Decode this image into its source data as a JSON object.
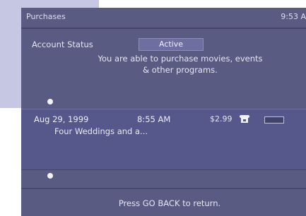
{
  "screen": {
    "title": "Purchases",
    "clock": "9:53 A"
  },
  "account": {
    "status_label": "Account Status",
    "status_value": "Active",
    "message_line1": "You are able to purchase movies, events",
    "message_line2": "& other programs."
  },
  "purchases": [
    {
      "date": "Aug 29, 1999",
      "time": "8:55 AM",
      "price": "$2.99",
      "title": "Four Weddings and a..."
    }
  ],
  "footer": {
    "instruction": "Press GO BACK to return."
  },
  "colors": {
    "panel": "#5a5b83",
    "list_background": "#56578a",
    "background_tile": "#c5c7e3"
  }
}
